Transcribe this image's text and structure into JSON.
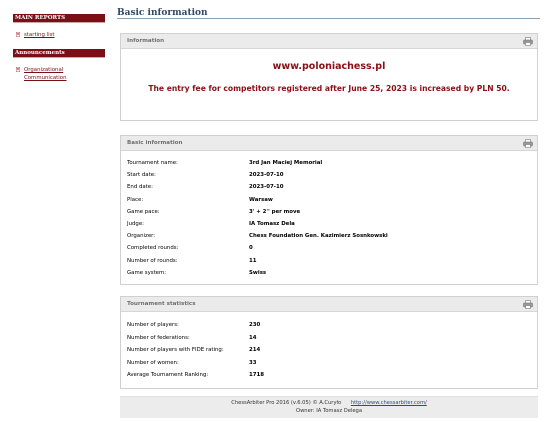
{
  "sidebar": {
    "main_reports_header": "MAIN REPORTS",
    "main_reports_items": [
      {
        "label": "starting list"
      }
    ],
    "announcements_header": "Announcements",
    "announcements_items": [
      {
        "label_line1": "Organizational",
        "label_line2": "Communication"
      }
    ]
  },
  "page_title": "Basic information",
  "info_panel": {
    "title": "Information",
    "website": "www.poloniachess.pl",
    "notice": "The entry fee for competitors registered after June 25, 2023 is increased by PLN 50."
  },
  "basic_panel": {
    "title": "Basic information",
    "rows": [
      {
        "key": "Tournament name:",
        "value": "3rd Jan Maciej Memorial"
      },
      {
        "key": "Start date:",
        "value": "2023-07-10"
      },
      {
        "key": "End date:",
        "value": "2023-07-10"
      },
      {
        "key": "Place:",
        "value": "Warsaw"
      },
      {
        "key": "Game pace:",
        "value": "3' + 2'' per move"
      },
      {
        "key": "Judge:",
        "value": "IA Tomasz Dela"
      },
      {
        "key": "Organizer:",
        "value": "Chess Foundation Gen. Kazimierz Sosnkowski"
      },
      {
        "key": "Completed rounds:",
        "value": "0"
      },
      {
        "key": "Number of rounds:",
        "value": "11"
      },
      {
        "key": "Game system:",
        "value": "Swiss"
      }
    ]
  },
  "stats_panel": {
    "title": "Tournament statistics",
    "rows": [
      {
        "key": "Number of players:",
        "value": "230"
      },
      {
        "key": "Number of federations:",
        "value": "14"
      },
      {
        "key": "Number of players with FIDE rating:",
        "value": "214"
      },
      {
        "key": "Number of women:",
        "value": "33"
      },
      {
        "key": "Average Tournament Ranking:",
        "value": "1718"
      }
    ]
  },
  "footer": {
    "credit": "ChessArbiter Pro 2016 (v.6.05) © A.Curyło",
    "link": "http://www.chessarbiter.com/",
    "owner": "Owner: IA Tomasz Delega"
  },
  "icons": {
    "print": "printer-icon",
    "bullet": "document-bullet-icon"
  },
  "colors": {
    "sidebar_header": "#7a0f16",
    "accent_red": "#8b0f14",
    "title_blue": "#2c4a66",
    "panel_header": "#ebebeb"
  }
}
